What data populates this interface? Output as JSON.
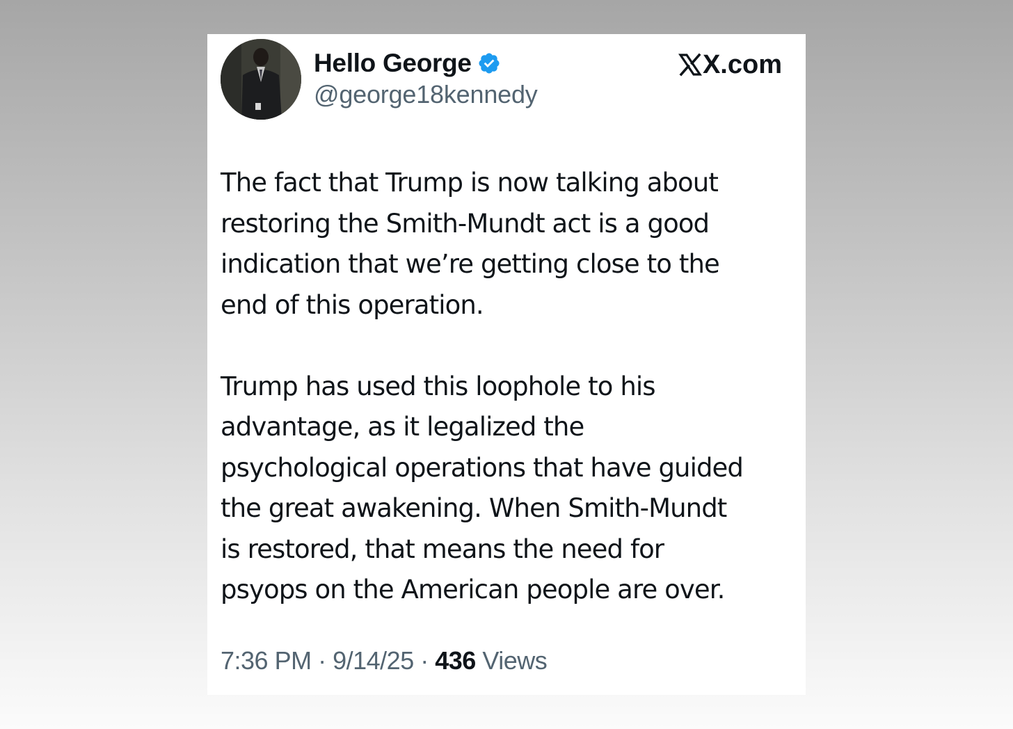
{
  "author": {
    "display_name": "Hello George",
    "handle": "@george18kennedy",
    "verified": true,
    "avatar_icon": "profile-photo-icon"
  },
  "brand": {
    "label": "X.com",
    "logo_icon": "x-logo-icon"
  },
  "tweet": {
    "paragraphs": [
      {
        "lines": [
          "The fact that Trump is now talking about",
          "restoring the Smith-Mundt act is a good",
          "indication that we’re getting close to the",
          "end of this operation."
        ]
      },
      {
        "lines": [
          "Trump has used this loophole to his",
          "advantage, as it legalized the",
          "psychological operations that have guided",
          "the great awakening. When Smith-Mundt",
          "is restored, that means the need for",
          "psyops on the American people are over."
        ]
      }
    ]
  },
  "meta": {
    "time": "7:36 PM",
    "separator": "·",
    "date": "9/14/25",
    "views_count": "436",
    "views_label": "Views"
  },
  "colors": {
    "text_primary": "#0f1419",
    "text_secondary": "#536471",
    "verified_blue": "#1d9bf0"
  }
}
